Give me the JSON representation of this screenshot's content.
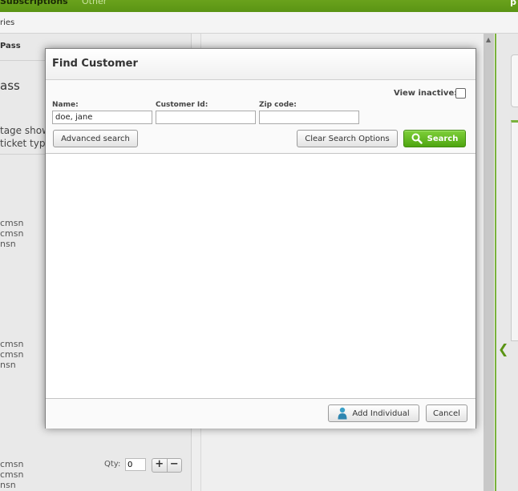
{
  "app": {
    "tabs": [
      "Subscriptions",
      "Other"
    ],
    "corner_text": "p",
    "breadcrumb": "ries"
  },
  "left_panel": {
    "header": "Pass",
    "title": "ass",
    "desc_line1": "tage show",
    "desc_line2": "ticket typ",
    "group1": [
      "cmsn",
      "cmsn",
      "nsn"
    ],
    "group2": [
      "cmsn",
      "cmsn",
      "nsn"
    ],
    "group3": [
      "cmsn",
      "cmsn",
      "nsn"
    ],
    "qty_label": "Qty:",
    "qty_value": "0",
    "qty_plus": "+",
    "qty_minus": "−"
  },
  "modal": {
    "title": "Find Customer",
    "view_inactive_label": "View inactive:",
    "view_inactive_checked": false,
    "fields": {
      "name_label": "Name:",
      "name_value": "doe, jane",
      "customer_id_label": "Customer Id:",
      "customer_id_value": "",
      "zip_label": "Zip code:",
      "zip_value": ""
    },
    "buttons": {
      "advanced_search": "Advanced search",
      "clear_search_options": "Clear Search Options",
      "search": "Search",
      "add_individual": "Add Individual",
      "cancel": "Cancel"
    },
    "icons": {
      "search": "magnifier-icon",
      "add_individual": "person-icon"
    }
  },
  "colors": {
    "brand_green": "#5a9414",
    "search_button_green": "#4ea510"
  }
}
